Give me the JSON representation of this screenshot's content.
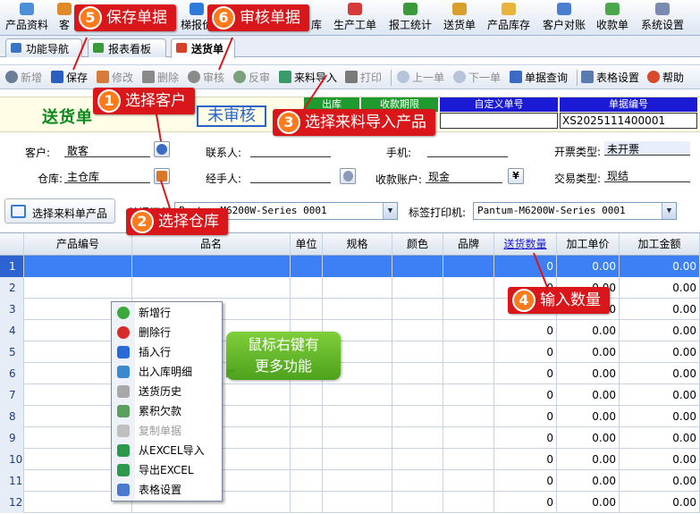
{
  "colors": {
    "accent_red": "#d9161a",
    "badge_orange": "#ff7a1a",
    "title_green": "#0a8a1c",
    "selected_row": "#3d7ff5",
    "stamp_blue": "#2a62c9",
    "header_blue": "#1b1bd6",
    "header_green": "#1f9a2e",
    "tip_green": "#4da21d"
  },
  "topmenu": [
    "产品资料",
    "客",
    "梯报价",
    "库",
    "生产工单",
    "报工统计",
    "送货单",
    "产品库存",
    "客户对账",
    "收款单",
    "系统设置"
  ],
  "tabs": [
    "功能导航",
    "报表看板",
    "送货单"
  ],
  "toolbar": {
    "new": "新增",
    "save": "保存",
    "edit": "修改",
    "delete": "删除",
    "audit": "审核",
    "unaudit": "反审",
    "import": "来料导入",
    "print": "打印",
    "prev": "上一单",
    "next": "下一单",
    "query": "单据查询",
    "table_settings": "表格设置",
    "help": "帮助"
  },
  "header": {
    "title": "送货单",
    "stamp": "未审核",
    "col_out": "出库",
    "col_due": "收款期限",
    "col_custom": "自定义单号",
    "col_docno": "单据编号",
    "docno": "XS2025111400001"
  },
  "form": {
    "customer_label": "客户:",
    "customer": "散客",
    "contact_label": "联系人:",
    "phone_label": "手机:",
    "invoice_type_label": "开票类型:",
    "invoice_type": "未开票",
    "warehouse_label": "仓库:",
    "warehouse": "主仓库",
    "handler_label": "经手人:",
    "account_label": "收款账户:",
    "account": "现金",
    "trade_type_label": "交易类型:",
    "trade_type": "现结"
  },
  "productbar": {
    "select_button": "选择来料单产品",
    "printer1_label": "单据打印",
    "printer1": "Pantum-M6200W-Series 0001",
    "printer2_label": "标签打印机:",
    "printer2": "Pantum-M6200W-Series 0001"
  },
  "grid": {
    "columns": [
      "",
      "产品编号",
      "品名",
      "单位",
      "规格",
      "颜色",
      "品牌",
      "送货数量",
      "加工单价",
      "加工金额"
    ],
    "rows": [
      [
        "1",
        "",
        "",
        "",
        "",
        "",
        "",
        "0",
        "0.00",
        "0.00"
      ],
      [
        "2",
        "",
        "",
        "",
        "",
        "",
        "",
        "0",
        "0.00",
        "0.00"
      ],
      [
        "3",
        "",
        "",
        "",
        "",
        "",
        "",
        "0",
        "0.00",
        "0.00"
      ],
      [
        "4",
        "",
        "",
        "",
        "",
        "",
        "",
        "0",
        "0.00",
        "0.00"
      ],
      [
        "5",
        "",
        "",
        "",
        "",
        "",
        "",
        "0",
        "0.00",
        "0.00"
      ],
      [
        "6",
        "",
        "",
        "",
        "",
        "",
        "",
        "0",
        "0.00",
        "0.00"
      ],
      [
        "7",
        "",
        "",
        "",
        "",
        "",
        "",
        "0",
        "0.00",
        "0.00"
      ],
      [
        "8",
        "",
        "",
        "",
        "",
        "",
        "",
        "0",
        "0.00",
        "0.00"
      ],
      [
        "9",
        "",
        "",
        "",
        "",
        "",
        "",
        "0",
        "0.00",
        "0.00"
      ],
      [
        "10",
        "",
        "",
        "",
        "",
        "",
        "",
        "0",
        "0.00",
        "0.00"
      ],
      [
        "11",
        "",
        "",
        "",
        "",
        "",
        "",
        "0",
        "0.00",
        "0.00"
      ],
      [
        "12",
        "",
        "",
        "",
        "",
        "",
        "",
        "0",
        "0.00",
        "0.00"
      ]
    ]
  },
  "context_menu": [
    "新增行",
    "删除行",
    "插入行",
    "出入库明细",
    "送货历史",
    "累积欠款",
    "复制单据",
    "从EXCEL导入",
    "导出EXCEL",
    "表格设置"
  ],
  "callouts": {
    "c1": "1",
    "c1_text": "选择客户",
    "c2": "2",
    "c2_text": "选择仓库",
    "c3": "3",
    "c3_text": "选择来料导入产品",
    "c4": "4",
    "c4_text": "输入数量",
    "c5": "5",
    "c5_text": "保存单据",
    "c6": "6",
    "c6_text": "审核单据"
  },
  "tip": {
    "line1": "鼠标右键有",
    "line2": "更多功能"
  }
}
